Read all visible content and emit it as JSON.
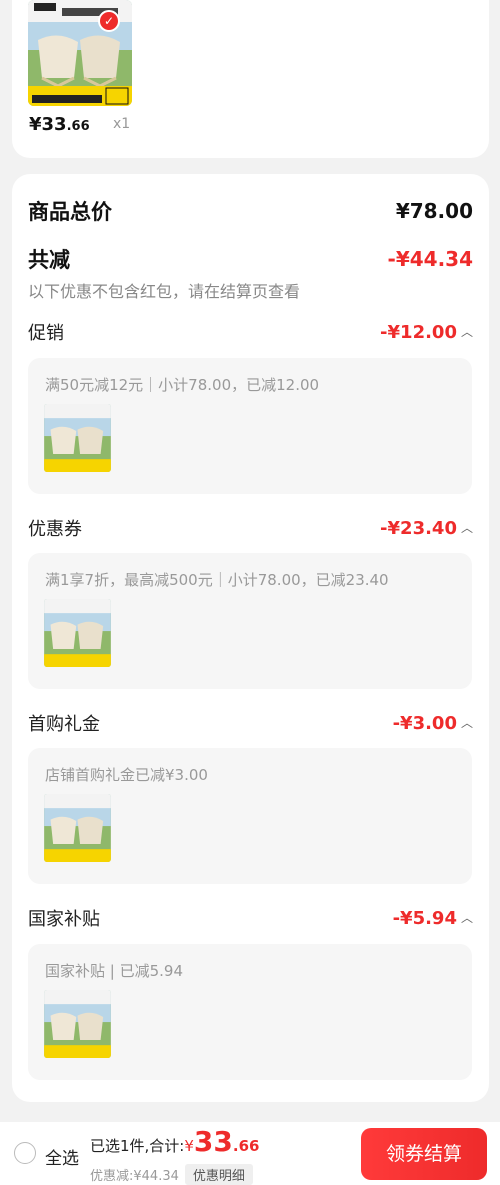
{
  "product": {
    "banner_text_1": "多用安全 休闲学院",
    "banner_text_2": "加厚管管 600D双层牛津布",
    "price_symbol": "¥",
    "price_int": "33",
    "price_dec": ".66",
    "quantity": "x1"
  },
  "summary": {
    "goods_total_label": "商品总价",
    "goods_total_value": "¥78.00",
    "total_reduce_label": "共减",
    "total_reduce_value": "-¥44.34",
    "note": "以下优惠不包含红包，请在结算页查看"
  },
  "sections": [
    {
      "title": "促销",
      "value": "-¥12.00",
      "desc": "满50元减12元｜小计78.00，已减12.00"
    },
    {
      "title": "优惠券",
      "value": "-¥23.40",
      "desc": "满1享7折，最高减500元｜小计78.00，已减23.40"
    },
    {
      "title": "首购礼金",
      "value": "-¥3.00",
      "desc": "店铺首购礼金已减¥3.00"
    },
    {
      "title": "国家补贴",
      "value": "-¥5.94",
      "desc": "国家补贴 | 已减5.94"
    }
  ],
  "bottom_bar": {
    "select_all": "全选",
    "selected_text": "已选1件,合计:",
    "total_symbol": "¥",
    "total_int": "33",
    "total_dec": ".66",
    "saving_text": "优惠减:¥44.34",
    "detail_button": "优惠明细",
    "checkout_button": "领券结算"
  },
  "colors": {
    "accent": "#ee2b2b",
    "background": "#f2f2f2"
  }
}
